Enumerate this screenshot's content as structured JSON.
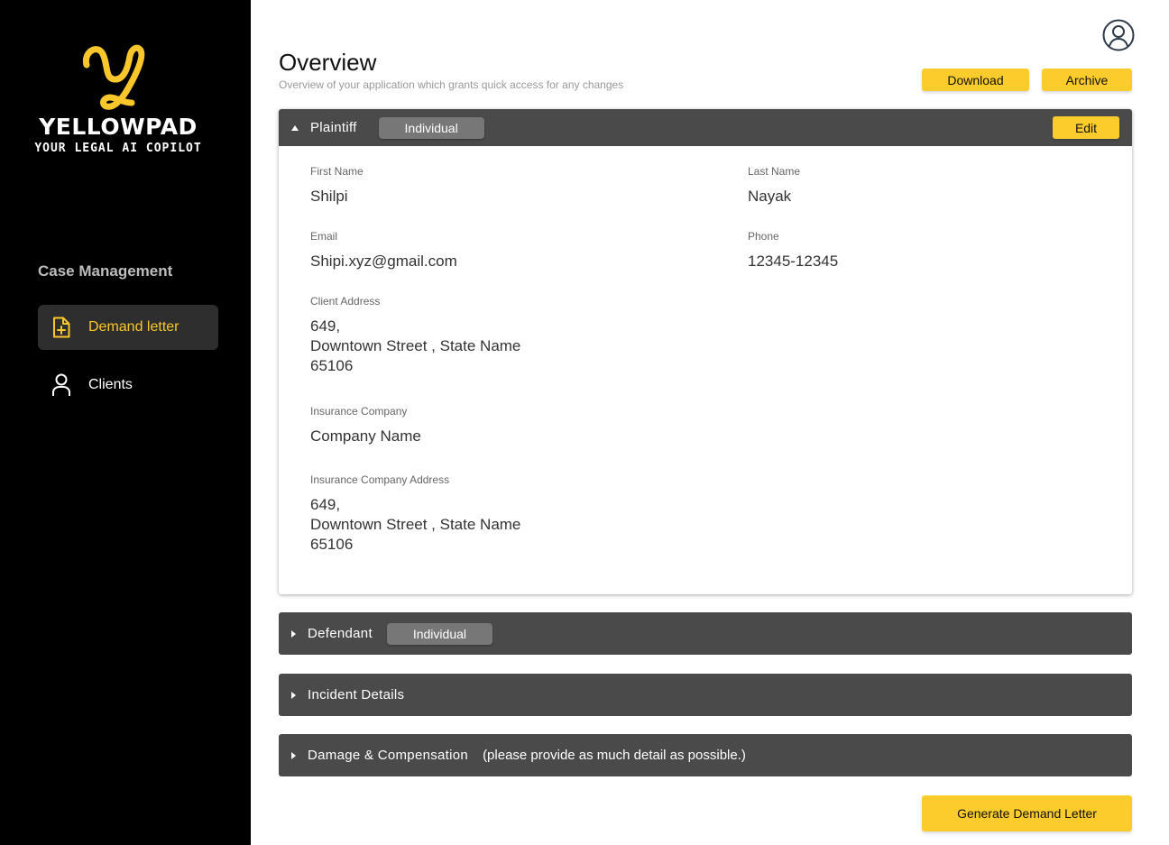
{
  "brand": {
    "name": "YELLOWPAD",
    "tagline": "YOUR LEGAL AI COPILOT",
    "accent": "#fccc2c"
  },
  "sidebar": {
    "section_title": "Case Management",
    "items": [
      {
        "label": "Demand letter",
        "icon": "document-plus-icon",
        "active": true
      },
      {
        "label": "Clients",
        "icon": "user-icon",
        "active": false
      }
    ]
  },
  "header": {
    "title": "Overview",
    "subtitle": "Overview of your application which grants quick access for any changes",
    "download_label": "Download",
    "archive_label": "Archive"
  },
  "plaintiff": {
    "title": "Plaintiff",
    "type_badge": "Individual",
    "edit_label": "Edit",
    "fields": {
      "first_name_label": "First Name",
      "first_name": "Shilpi",
      "last_name_label": "Last Name",
      "last_name": "Nayak",
      "email_label": "Email",
      "email": "Shipi.xyz@gmail.com",
      "phone_label": "Phone",
      "phone": "12345-12345",
      "address_label": "Client Address",
      "address": "649,\nDowntown Street , State Name\n65106",
      "insurance_label": "Insurance Company",
      "insurance": "Company Name",
      "insurance_address_label": "Insurance Company Address",
      "insurance_address": "649,\nDowntown Street , State Name\n65106"
    }
  },
  "defendant": {
    "title": "Defendant",
    "type_badge": "Individual"
  },
  "incident": {
    "title": "Incident Details"
  },
  "damage": {
    "title": "Damage & Compensation",
    "note": "(please provide as much detail as possible.)"
  },
  "footer": {
    "generate_label": "Generate Demand Letter"
  }
}
